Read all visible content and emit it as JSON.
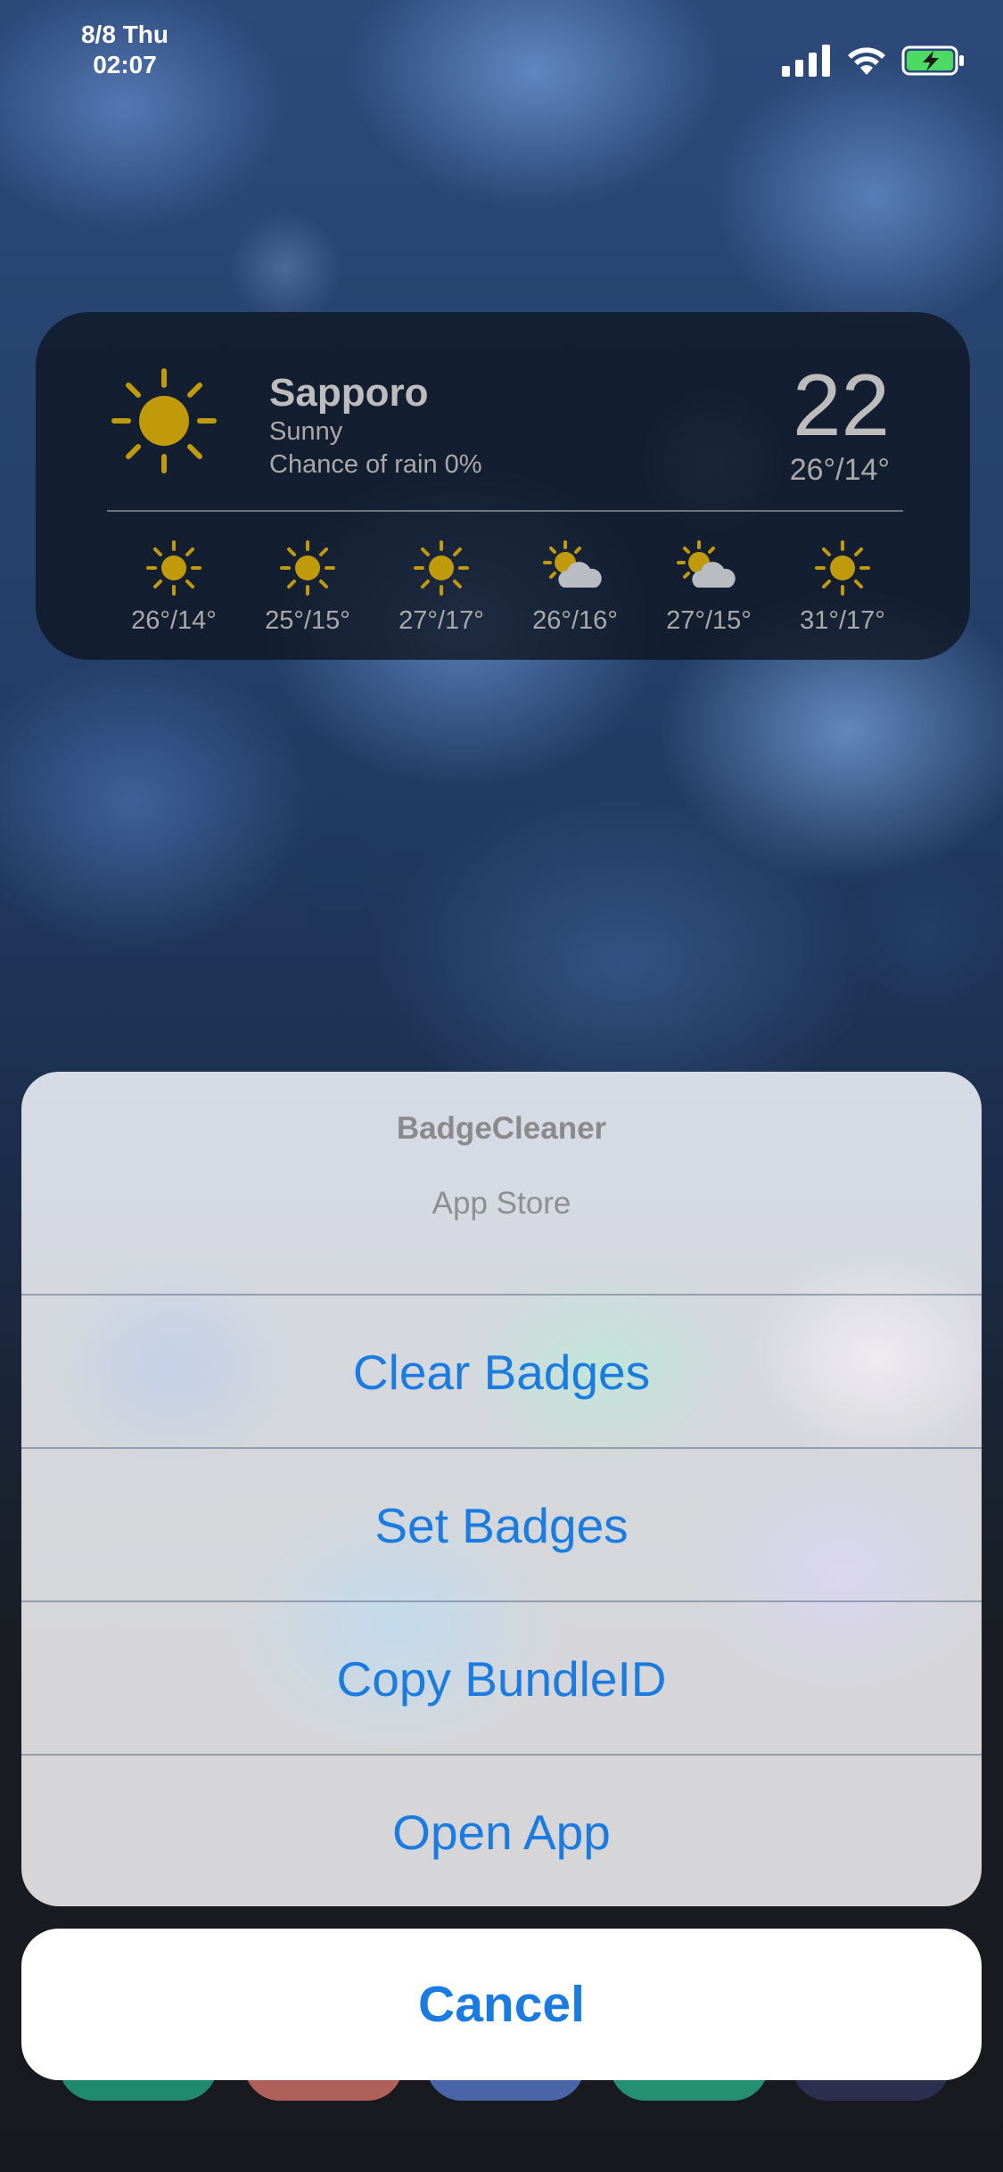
{
  "status_bar": {
    "date": "8/8 Thu",
    "time": "02:07",
    "icons": [
      "signal-icon",
      "wifi-icon",
      "battery-charging-icon"
    ],
    "battery_color": "#4cd964"
  },
  "weather": {
    "city": "Sapporo",
    "condition": "Sunny",
    "rain": "Chance of rain 0%",
    "temperature": "22",
    "hi_lo": "26°/14°",
    "icon": "sun-icon",
    "sun_color": "#c09a0a",
    "forecast": [
      {
        "icon": "sun-icon",
        "temps": "26°/14°"
      },
      {
        "icon": "sun-icon",
        "temps": "25°/15°"
      },
      {
        "icon": "sun-icon",
        "temps": "27°/17°"
      },
      {
        "icon": "partly-cloudy-icon",
        "temps": "26°/16°"
      },
      {
        "icon": "partly-cloudy-icon",
        "temps": "27°/15°"
      },
      {
        "icon": "sun-icon",
        "temps": "31°/17°"
      }
    ]
  },
  "action_sheet": {
    "title": "BadgeCleaner",
    "subtitle": "App Store",
    "actions": [
      "Clear Badges",
      "Set Badges",
      "Copy BundleID",
      "Open App"
    ],
    "cancel": "Cancel",
    "accent_color": "#1a7ce0"
  }
}
